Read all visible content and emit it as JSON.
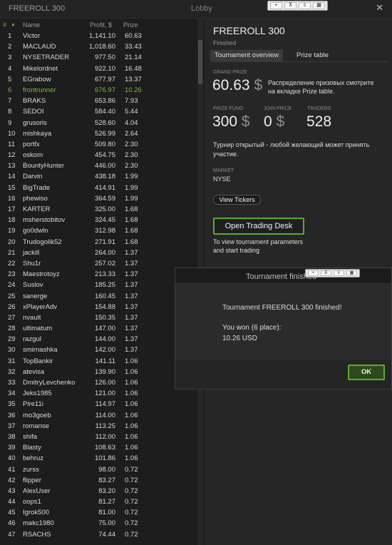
{
  "window": {
    "app_title": "FREEROLL 300",
    "title": "Lobby",
    "controls": [
      "•",
      "⊼",
      "⇩",
      "▦"
    ],
    "close_glyph": "✕"
  },
  "list": {
    "headers": {
      "rank": "#",
      "sort_glyph": "▲",
      "name": "Name",
      "profit": "Profit, $",
      "prize": "Prize"
    },
    "highlight_color": "#6fbf3f",
    "rows": [
      {
        "rank": "1",
        "name": "Victor",
        "profit": "1,141.10",
        "prize": "60.63"
      },
      {
        "rank": "2",
        "name": "MACLAUD",
        "profit": "1,018.60",
        "prize": "33.43"
      },
      {
        "rank": "3",
        "name": "NYSETRADER",
        "profit": "977.50",
        "prize": "21.14"
      },
      {
        "rank": "4",
        "name": "Mikelordnet",
        "profit": "922.10",
        "prize": "16.48"
      },
      {
        "rank": "5",
        "name": "EGrabow",
        "profit": "677.97",
        "prize": "13.37"
      },
      {
        "rank": "6",
        "name": "frontrunner",
        "profit": "676.97",
        "prize": "10.26",
        "self": true
      },
      {
        "rank": "7",
        "name": "BRAKS",
        "profit": "653.86",
        "prize": "7.93"
      },
      {
        "rank": "8",
        "name": "SEDOI",
        "profit": "584.40",
        "prize": "5.44"
      },
      {
        "rank": "9",
        "name": "grusoris",
        "profit": "528.60",
        "prize": "4.04"
      },
      {
        "rank": "10",
        "name": "mishkaya",
        "profit": "526.99",
        "prize": "2.64"
      },
      {
        "rank": "11",
        "name": "portfx",
        "profit": "509.80",
        "prize": "2.30"
      },
      {
        "rank": "12",
        "name": "oskom",
        "profit": "454.75",
        "prize": "2.30"
      },
      {
        "rank": "13",
        "name": "BountyHunter",
        "profit": "446.00",
        "prize": "2.30"
      },
      {
        "rank": "14",
        "name": "Darvin",
        "profit": "438.18",
        "prize": "1.99"
      },
      {
        "rank": "15",
        "name": "BigTrade",
        "profit": "414.91",
        "prize": "1.99"
      },
      {
        "rank": "16",
        "name": "phewiso",
        "profit": "364.59",
        "prize": "1.99"
      },
      {
        "rank": "17",
        "name": "KARTER",
        "profit": "325.00",
        "prize": "1.68"
      },
      {
        "rank": "18",
        "name": "msherstobitov",
        "profit": "324.45",
        "prize": "1.68"
      },
      {
        "rank": "19",
        "name": "go0dwln",
        "profit": "312.98",
        "prize": "1.68"
      },
      {
        "rank": "20",
        "name": "Trudogolik52",
        "profit": "271.91",
        "prize": "1.68"
      },
      {
        "rank": "21",
        "name": "jackill",
        "profit": "264.00",
        "prize": "1.37"
      },
      {
        "rank": "22",
        "name": "Shu1r",
        "profit": "257.02",
        "prize": "1.37"
      },
      {
        "rank": "23",
        "name": "Maestrotoyz",
        "profit": "213.33",
        "prize": "1.37"
      },
      {
        "rank": "24",
        "name": "Suslov",
        "profit": "185.25",
        "prize": "1.37"
      },
      {
        "rank": "25",
        "name": "sanerge",
        "profit": "160.45",
        "prize": "1.37"
      },
      {
        "rank": "26",
        "name": "xPlayerAdv",
        "profit": "154.88",
        "prize": "1.37"
      },
      {
        "rank": "27",
        "name": "nvault",
        "profit": "150.35",
        "prize": "1.37"
      },
      {
        "rank": "28",
        "name": "ultimatum",
        "profit": "147.00",
        "prize": "1.37"
      },
      {
        "rank": "29",
        "name": "razgul",
        "profit": "144.00",
        "prize": "1.37"
      },
      {
        "rank": "30",
        "name": "smirnashka",
        "profit": "142.00",
        "prize": "1.37"
      },
      {
        "rank": "31",
        "name": "TopBankir",
        "profit": "141.11",
        "prize": "1.06"
      },
      {
        "rank": "32",
        "name": "atevisa",
        "profit": "139.90",
        "prize": "1.06"
      },
      {
        "rank": "33",
        "name": "DmitryLevchenko",
        "profit": "126.00",
        "prize": "1.06"
      },
      {
        "rank": "34",
        "name": "Jeks1985",
        "profit": "121.00",
        "prize": "1.06"
      },
      {
        "rank": "35",
        "name": "Pire11i",
        "profit": "114.97",
        "prize": "1.06"
      },
      {
        "rank": "36",
        "name": "mo3goeb",
        "profit": "114.00",
        "prize": "1.06"
      },
      {
        "rank": "37",
        "name": "romanse",
        "profit": "113.25",
        "prize": "1.06"
      },
      {
        "rank": "38",
        "name": "shifa",
        "profit": "112.00",
        "prize": "1.06"
      },
      {
        "rank": "39",
        "name": "Blasty",
        "profit": "108.63",
        "prize": "1.06"
      },
      {
        "rank": "40",
        "name": "behruz",
        "profit": "101.86",
        "prize": "1.06"
      },
      {
        "rank": "41",
        "name": "zurss",
        "profit": "98.00",
        "prize": "0.72"
      },
      {
        "rank": "42",
        "name": "flipper",
        "profit": "83.27",
        "prize": "0.72"
      },
      {
        "rank": "43",
        "name": "AlexUser",
        "profit": "83.20",
        "prize": "0.72"
      },
      {
        "rank": "44",
        "name": "oops1",
        "profit": "81.27",
        "prize": "0.72"
      },
      {
        "rank": "45",
        "name": "Igrok500",
        "profit": "81.00",
        "prize": "0.72"
      },
      {
        "rank": "46",
        "name": "makc1980",
        "profit": "75.00",
        "prize": "0.72"
      },
      {
        "rank": "47",
        "name": "RSACHS",
        "profit": "74.44",
        "prize": "0.72"
      }
    ]
  },
  "detail": {
    "title": "FREEROLL 300",
    "status": "Finished",
    "tabs": [
      "Tournament overview",
      "Prize table"
    ],
    "grand_prize_label": "GRAND PRIZE",
    "grand_prize_value": "60.63",
    "currency": "$",
    "prize_note_1": "Распределение призовых смотрите",
    "prize_note_2": "на вкладке Prize table.",
    "prize_fund_label": "PRIZE FUND",
    "prize_fund_value": "300",
    "join_price_label": "JOIN PRICE",
    "join_price_value": "0",
    "traders_label": "TRADERS",
    "traders_value": "528",
    "open_note_1": "Турнир открытый - любой желающий может принять",
    "open_note_2": "участие.",
    "market_label": "MARKET",
    "market_value": "NYSE",
    "view_tickers_label": "View Tickers",
    "open_desk_label": "Open Trading Desk",
    "desk_note_1": "To view tournament parameters",
    "desk_note_2": "and start trading"
  },
  "dialog": {
    "title": "Tournament finished",
    "message": "Tournament FREEROLL 300 finished!",
    "result": "You won (6 place):",
    "amount": "10.26 USD",
    "ok_label": "OK"
  },
  "colors": {
    "accent_green": "#5aaa35"
  }
}
